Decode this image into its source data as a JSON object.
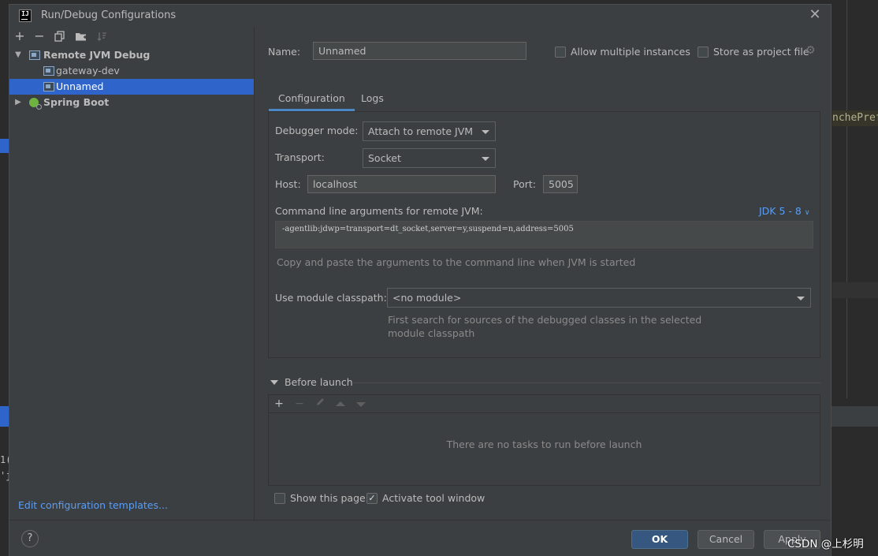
{
  "background": {
    "right_code": "nchePref",
    "left_code": [
      "1(",
      "'j"
    ]
  },
  "dialog": {
    "title": "Run/Debug Configurations",
    "app_icon_text": "IJ"
  },
  "sidebar": {
    "toolbar": [
      "add",
      "remove",
      "copy",
      "new-folder",
      "sort"
    ],
    "tree": [
      {
        "label": "Remote JVM Debug",
        "type": "group",
        "expanded": true
      },
      {
        "label": "gateway-dev",
        "type": "config"
      },
      {
        "label": "Unnamed",
        "type": "config",
        "selected": true
      },
      {
        "label": "Spring Boot",
        "type": "group",
        "expanded": false
      }
    ],
    "edit_templates_link": "Edit configuration templates..."
  },
  "form": {
    "name_label": "Name:",
    "name_value": "Unnamed",
    "allow_multiple_label": "Allow multiple instances",
    "store_project_label": "Store as project file",
    "tabs": [
      {
        "label": "Configuration",
        "active": true
      },
      {
        "label": "Logs",
        "active": false
      }
    ],
    "debugger_mode_label": "Debugger mode:",
    "debugger_mode_value": "Attach to remote JVM",
    "transport_label": "Transport:",
    "transport_value": "Socket",
    "host_label": "Host:",
    "host_value": "localhost",
    "port_label": "Port:",
    "port_value": "5005",
    "cmd_label": "Command line arguments for remote JVM:",
    "jdk_link": "JDK 5 - 8",
    "cmd_value": "-agentlib:jdwp=transport=dt_socket,server=y,suspend=n,address=5005",
    "cmd_hint": "Copy and paste the arguments to the command line when JVM is started",
    "module_label": "Use module classpath:",
    "module_value": "<no module>",
    "module_hint_1": "First search for sources of the debugged classes in the selected",
    "module_hint_2": "module classpath"
  },
  "before_launch": {
    "title": "Before launch",
    "empty_text": "There are no tasks to run before launch"
  },
  "footer": {
    "show_page_label": "Show this page",
    "activate_tool_label": "Activate tool window",
    "help": "?",
    "ok": "OK",
    "cancel": "Cancel",
    "apply": "Apply",
    "watermark": "CSDN @上杉明"
  },
  "colors": {
    "selection": "#2f65ca",
    "link": "#589df6",
    "primary_button": "#365880"
  }
}
